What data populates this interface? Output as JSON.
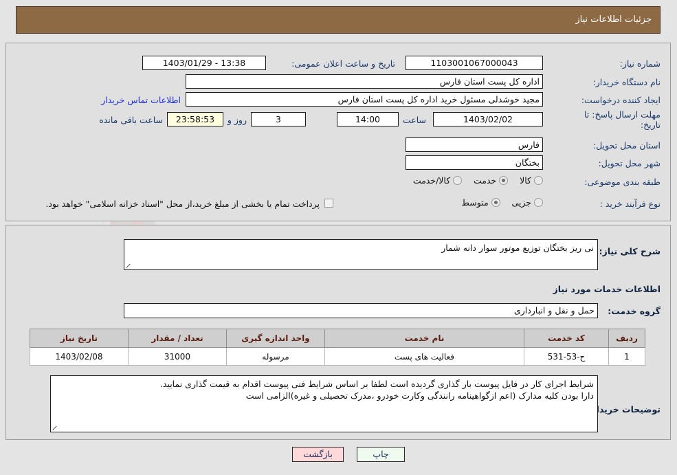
{
  "header": {
    "title": "جزئیات اطلاعات نیاز"
  },
  "form": {
    "need_number_label": "شماره نیاز:",
    "need_number_value": "1103001067000043",
    "announce_label": "تاریخ و ساعت اعلان عمومی:",
    "announce_value": "13:38 - 1403/01/29",
    "buyer_org_label": "نام دستگاه خریدار:",
    "buyer_org_value": "اداره کل پست استان فارس",
    "creator_label": "ایجاد کننده درخواست:",
    "creator_value": "مجید خوشدلی مسئول خرید اداره کل پست استان فارس",
    "contact_link": "اطلاعات تماس خریدار",
    "deadline_label": "مهلت ارسال پاسخ: تا تاریخ:",
    "deadline_date": "1403/02/02",
    "hour_label": "ساعت",
    "hour_value": "14:00",
    "days_value": "3",
    "days_label": "روز و",
    "remaining_value": "23:58:53",
    "remaining_label": "ساعت باقی مانده",
    "province_label": "استان محل تحویل:",
    "province_value": "فارس",
    "city_label": "شهر محل تحویل:",
    "city_value": "بختگان",
    "category_label": "طبقه بندی موضوعی:",
    "category_options": [
      "کالا",
      "خدمت",
      "کالا/خدمت"
    ],
    "category_selected": "خدمت",
    "process_label": "نوع فرآیند خرید :",
    "process_options": [
      "جزیی",
      "متوسط"
    ],
    "process_selected": "متوسط",
    "treasury_checkbox_label": "پرداخت تمام یا بخشی از مبلغ خرید،از محل \"اسناد خزانه اسلامی\" خواهد بود.",
    "treasury_checked": false
  },
  "description": {
    "label": "شرح کلی نیاز:",
    "value": "نی ریز بختگان توزیع موتور سوار دانه شمار"
  },
  "services_section": {
    "heading": "اطلاعات خدمات مورد نیاز",
    "group_label": "گروه خدمت:",
    "group_value": "حمل و نقل و انبارداری"
  },
  "table": {
    "headers": [
      "ردیف",
      "کد خدمت",
      "نام خدمت",
      "واحد اندازه گیری",
      "تعداد / مقدار",
      "تاریخ نیاز"
    ],
    "rows": [
      {
        "index": "1",
        "code": "ح-53-531",
        "name": "فعالیت های پست",
        "unit": "مرسوله",
        "quantity": "31000",
        "need_date": "1403/02/08"
      }
    ]
  },
  "notes": {
    "label": "توضیحات خریدار:",
    "line1": "شرایط اجرای کار در فایل پیوست بار گذاری گردیده است لطفا بر اساس شرایط فنی پیوست اقدام به قیمت گذاری نمایید.",
    "line2": "دارا بودن کلیه مدارک (اعم ازگواهینامه رانندگی وکارت خودرو ،مدرک تحصیلی و غیره)الزامی است"
  },
  "buttons": {
    "print": "چاپ",
    "back": "بازگشت"
  },
  "watermark": {
    "text": "AriaTender.net"
  }
}
